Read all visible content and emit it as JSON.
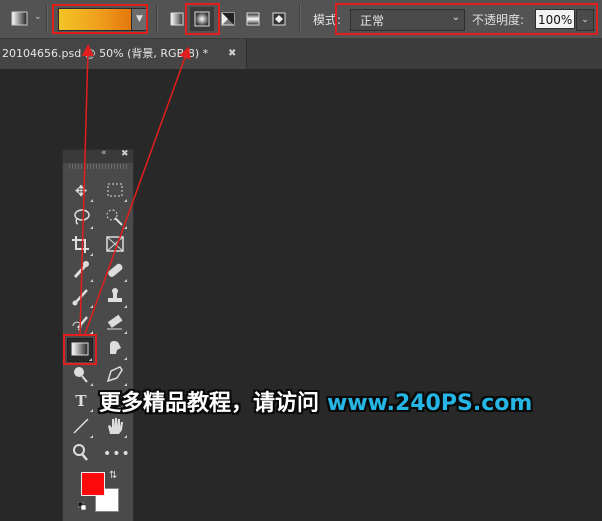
{
  "options_bar": {
    "gradient_preset": {
      "colors": [
        "#f3c426",
        "#e4780e"
      ]
    },
    "gradient_types": [
      {
        "icon": "linear-gradient-icon",
        "selected": false
      },
      {
        "icon": "radial-gradient-icon",
        "selected": true
      },
      {
        "icon": "angle-gradient-icon",
        "selected": false
      },
      {
        "icon": "reflected-gradient-icon",
        "selected": false
      },
      {
        "icon": "diamond-gradient-icon",
        "selected": false
      }
    ],
    "mode_label": "模式:",
    "mode_value": "正常",
    "opacity_label": "不透明度:",
    "opacity_value": "100%"
  },
  "document_tab": {
    "title": "20104656.psd @ 50% (背景, RGB/8) *",
    "close_icon": "close-icon"
  },
  "toolbox": {
    "colors": {
      "foreground": "#fa0a0a",
      "background": "#ffffff"
    },
    "selected_tool": "gradient-tool"
  },
  "watermark": {
    "text": "更多精品教程，请访问",
    "url": "www.240PS.com"
  },
  "annotation": {
    "color": "#e21e1e"
  }
}
